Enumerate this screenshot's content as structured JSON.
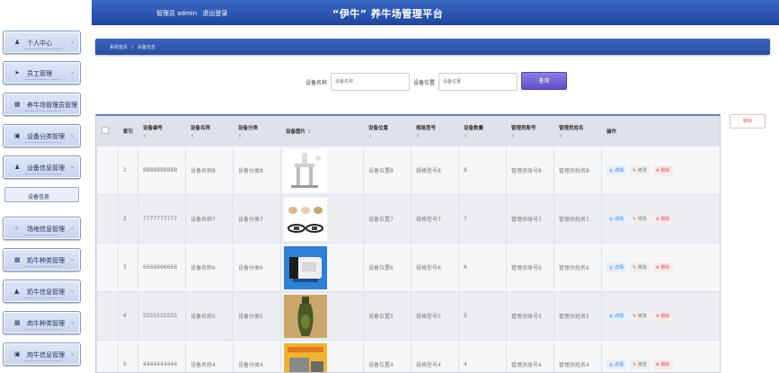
{
  "header": {
    "user_label": "管理员 admin",
    "logout_label": "退出登录",
    "title": "“伊牛” 养牛场管理平台"
  },
  "sidebar": {
    "items": [
      {
        "icon": "user-icon",
        "label": "个人中心"
      },
      {
        "icon": "send-icon",
        "label": "员工管理"
      },
      {
        "icon": "grid-icon",
        "label": "养牛场管理员管理"
      },
      {
        "icon": "briefcase-icon",
        "label": "设备分类管理"
      },
      {
        "icon": "user-icon",
        "label": "设备信息管理"
      },
      {
        "icon": "hand-icon",
        "label": "场地信息管理"
      },
      {
        "icon": "grid-icon",
        "label": "奶牛种类管理"
      },
      {
        "icon": "cattle-icon",
        "label": "奶牛信息管理"
      },
      {
        "icon": "grid-icon",
        "label": "肉牛种类管理"
      },
      {
        "icon": "monitor-icon",
        "label": "肉牛信息管理"
      }
    ],
    "sub_item": "设备信息"
  },
  "breadcrumb": {
    "home": "系统首页",
    "sep": "/",
    "current": "设备信息"
  },
  "search": {
    "name_label": "设备名称",
    "name_placeholder": "设备名称",
    "location_label": "设备位置",
    "location_placeholder": "设备位置",
    "button": "查询"
  },
  "delete_outside": "删除",
  "table": {
    "columns": [
      "",
      "索引",
      "设备编号",
      "设备名称",
      "设备分类",
      "设备图片",
      "设备位置",
      "规格型号",
      "设备数量",
      "管理员账号",
      "管理员姓名",
      "操作"
    ],
    "actions": {
      "detail": "◎ 详情",
      "edit": "✎ 修改",
      "del": "⊗ 删除"
    },
    "rows": [
      {
        "idx": "1",
        "code": "8888888888",
        "name": "设备名称8",
        "cat": "设备分类8",
        "loc": "设备位置8",
        "model": "规格型号8",
        "qty": "8",
        "acct": "管理员账号8",
        "admin": "管理员姓名8"
      },
      {
        "idx": "2",
        "code": "7777777777",
        "name": "设备名称7",
        "cat": "设备分类7",
        "loc": "设备位置7",
        "model": "规格型号7",
        "qty": "7",
        "acct": "管理员账号7",
        "admin": "管理员姓名7"
      },
      {
        "idx": "3",
        "code": "6666666666",
        "name": "设备名称6",
        "cat": "设备分类6",
        "loc": "设备位置6",
        "model": "规格型号6",
        "qty": "6",
        "acct": "管理员账号6",
        "admin": "管理员姓名6"
      },
      {
        "idx": "4",
        "code": "5555555555",
        "name": "设备名称5",
        "cat": "设备分类5",
        "loc": "设备位置5",
        "model": "规格型号5",
        "qty": "5",
        "acct": "管理员账号5",
        "admin": "管理员姓名5"
      },
      {
        "idx": "5",
        "code": "4444444444",
        "name": "设备名称4",
        "cat": "设备分类4",
        "loc": "设备位置4",
        "model": "规格型号4",
        "qty": "4",
        "acct": "管理员账号4",
        "admin": "管理员姓名4"
      }
    ]
  }
}
